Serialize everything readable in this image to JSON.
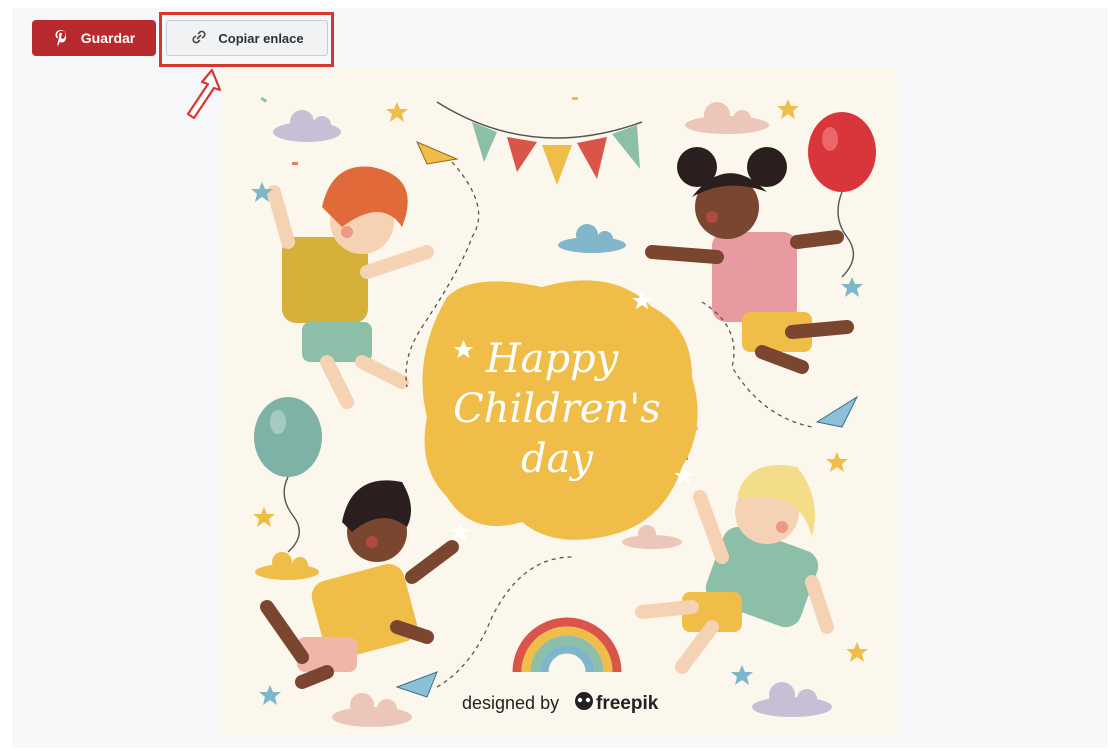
{
  "toolbar": {
    "save_label": "Guardar",
    "copy_link_label": "Copiar enlace"
  },
  "artwork": {
    "headline": [
      "Happy",
      "Children's",
      "day"
    ],
    "credit_prefix": "designed by",
    "credit_brand": "freepik"
  },
  "colors": {
    "save_bg": "#b92a2e",
    "highlight": "#d9362d",
    "blob": "#f0bd48",
    "paper": "#fcf7ec"
  },
  "icons": [
    "pinterest-icon",
    "link-icon",
    "annotation-arrow-icon",
    "freepik-logo-icon"
  ]
}
